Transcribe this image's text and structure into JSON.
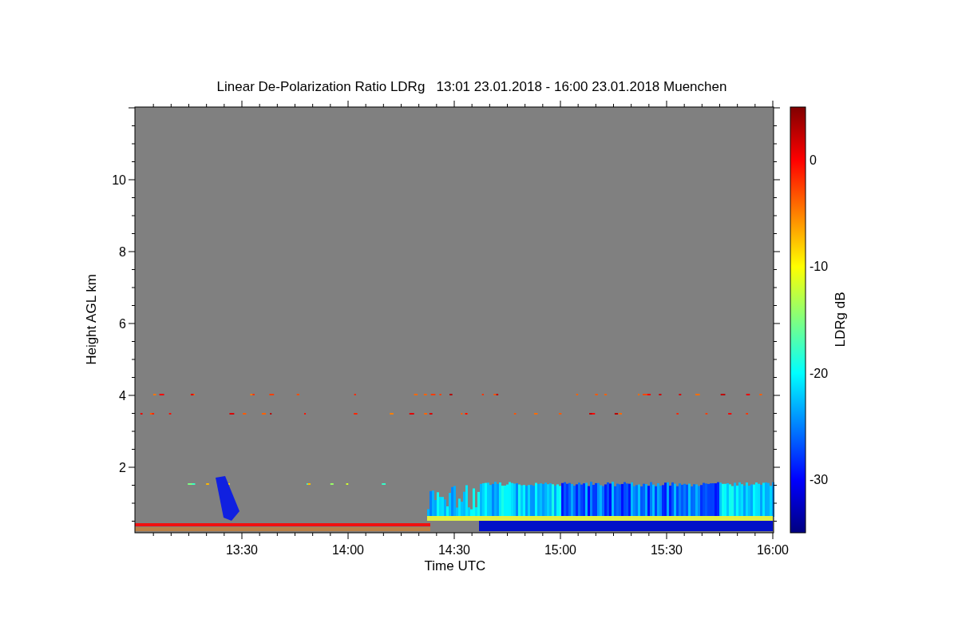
{
  "title": "Linear De-Polarization Ratio LDRg   13:01 23.01.2018 - 16:00 23.01.2018 Muenchen",
  "plot": {
    "xlabel": "Time UTC",
    "ylabel": "Height AGL km",
    "xticks": [
      "13:30",
      "14:00",
      "14:30",
      "15:00",
      "15:30",
      "16:00"
    ],
    "yticks": [
      "10",
      "8",
      "6",
      "4",
      "2"
    ]
  },
  "colorbar": {
    "label": "LDRg dB",
    "ticks": [
      "0",
      "-10",
      "-20",
      "-30"
    ]
  }
}
